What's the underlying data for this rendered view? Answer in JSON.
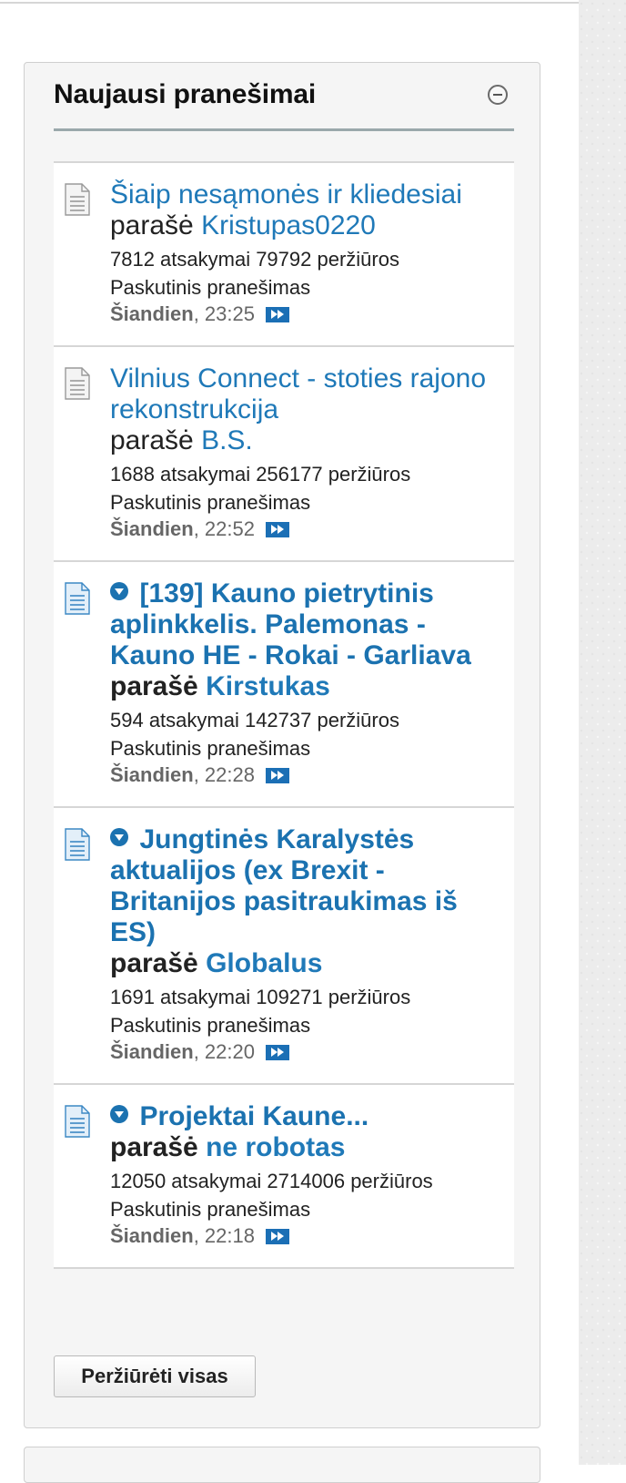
{
  "panel": {
    "title": "Naujausi pranešimai",
    "view_all_label": "Peržiūrėti visas"
  },
  "topics": [
    {
      "title": "Šiaip nesąmonės ir kliedesiai",
      "author_prefix": "parašė",
      "author": "Kristupas0220",
      "stats": "7812 atsakymai 79792 peržiūros",
      "last_label": "Paskutinis pranešimas",
      "last_day": "Šiandien",
      "last_time": ", 23:25",
      "unread": false
    },
    {
      "title": "Vilnius Connect - stoties rajono rekonstrukcija",
      "author_prefix": "parašė",
      "author": "B.S.",
      "stats": "1688 atsakymai 256177 peržiūros",
      "last_label": "Paskutinis pranešimas",
      "last_day": "Šiandien",
      "last_time": ", 22:52",
      "unread": false
    },
    {
      "title": "[139] Kauno pietrytinis aplinkkelis. Palemonas - Kauno HE - Rokai - Garliava",
      "author_prefix": "parašė",
      "author": "Kirstukas",
      "stats": "594 atsakymai 142737 peržiūros",
      "last_label": "Paskutinis pranešimas",
      "last_day": "Šiandien",
      "last_time": ", 22:28",
      "unread": true
    },
    {
      "title": "Jungtinės Karalystės aktualijos (ex Brexit - Britanijos pasitraukimas iš ES)",
      "author_prefix": "parašė",
      "author": "Globalus",
      "stats": "1691 atsakymai 109271 peržiūros",
      "last_label": "Paskutinis pranešimas",
      "last_day": "Šiandien",
      "last_time": ", 22:20",
      "unread": true
    },
    {
      "title": "Projektai Kaune...",
      "author_prefix": "parašė",
      "author": "ne robotas",
      "stats": "12050 atsakymai 2714006 peržiūros",
      "last_label": "Paskutinis pranešimas",
      "last_day": "Šiandien",
      "last_time": ", 22:18",
      "unread": true
    }
  ],
  "colors": {
    "link": "#1f79b8",
    "goto_icon": "#1b6fb5",
    "read_topic_icon": "#9a9a9a",
    "unread_topic_icon": "#3c88c4"
  }
}
